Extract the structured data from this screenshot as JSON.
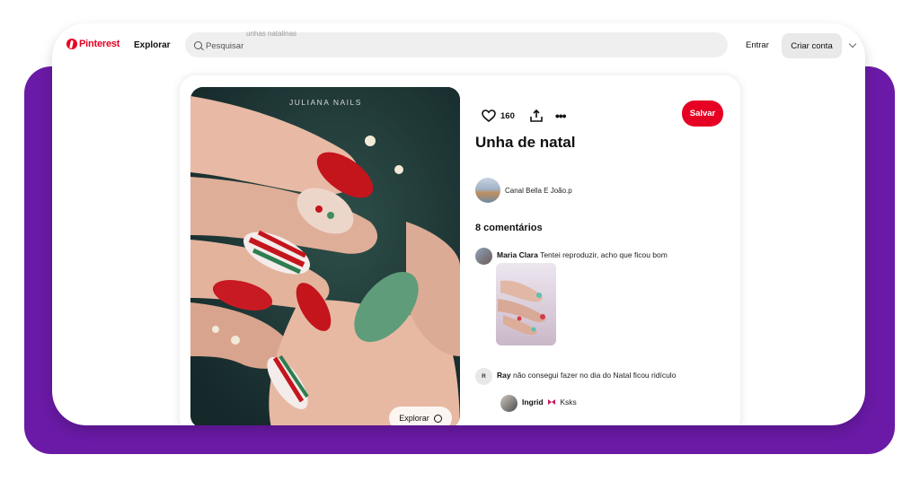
{
  "header": {
    "brand": "Pinterest",
    "nav_explore": "Explorar",
    "search_placeholder": "Pesquisar",
    "search_ghost": "unhas natalinas",
    "login_label": "Entrar",
    "signup_label": "Criar conta"
  },
  "pin": {
    "image_brand": "JULIANA NAILS",
    "explore_chip": "Explorar",
    "likes": "160",
    "save_label": "Salvar",
    "title": "Unha de natal",
    "author": "Canal Bella E João.p",
    "comments_title": "8 comentários",
    "comments": [
      {
        "user": "Maria Clara",
        "text": "Tentei reproduzir, acho que ficou bom"
      },
      {
        "user": "Ray",
        "initial": "R",
        "text": "não consegui fazer no dia do Natal ficou ridículo"
      },
      {
        "user": "Ingrid",
        "text": "Ksks"
      }
    ]
  },
  "colors": {
    "brand_red": "#e60023",
    "purple_bg": "#6a1aa6"
  },
  "icons": [
    "pinterest-logo-icon",
    "search-icon",
    "chevron-down-icon",
    "heart-icon",
    "share-icon",
    "more-icon",
    "lens-icon",
    "butterfly-icon"
  ]
}
